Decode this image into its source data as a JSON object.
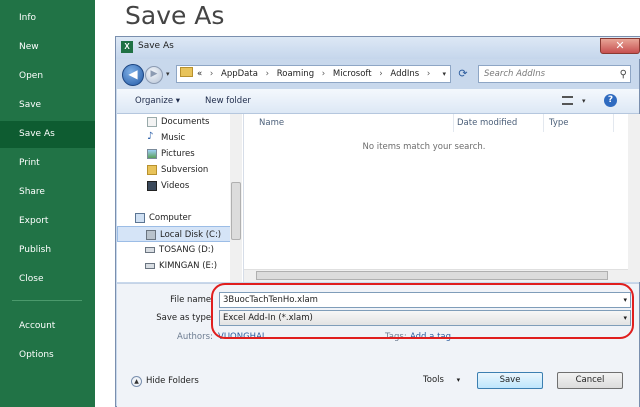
{
  "backstage": {
    "title": "Save As",
    "nav": [
      {
        "label": "Info",
        "active": false
      },
      {
        "label": "New",
        "active": false
      },
      {
        "label": "Open",
        "active": false
      },
      {
        "label": "Save",
        "active": false
      },
      {
        "label": "Save As",
        "active": true
      },
      {
        "label": "Print",
        "active": false
      },
      {
        "label": "Share",
        "active": false
      },
      {
        "label": "Export",
        "active": false
      },
      {
        "label": "Publish",
        "active": false
      },
      {
        "label": "Close",
        "active": false
      },
      {
        "label": "Account",
        "active": false
      },
      {
        "label": "Options",
        "active": false
      }
    ],
    "accent_color": "#217346"
  },
  "dialog": {
    "title": "Save As",
    "close_glyph": "✕",
    "address": {
      "prefix": "«",
      "path": [
        "AppData",
        "Roaming",
        "Microsoft",
        "AddIns"
      ]
    },
    "search_placeholder": "Search AddIns",
    "toolbar": {
      "organize_label": "Organize ▾",
      "new_folder_label": "New folder"
    },
    "nav_pane": [
      {
        "label": "Documents",
        "icon": "documents-icon"
      },
      {
        "label": "Music",
        "icon": "music-icon"
      },
      {
        "label": "Pictures",
        "icon": "pictures-icon"
      },
      {
        "label": "Subversion",
        "icon": "folder-icon"
      },
      {
        "label": "Videos",
        "icon": "videos-icon"
      },
      {
        "label": "Computer",
        "icon": "computer-icon"
      },
      {
        "label": "Local Disk (C:)",
        "icon": "disk-icon",
        "selected": true
      },
      {
        "label": "TOSANG (D:)",
        "icon": "drive-icon"
      },
      {
        "label": "KIMNGAN (E:)",
        "icon": "drive-icon"
      }
    ],
    "columns": [
      "Name",
      "Date modified",
      "Type"
    ],
    "empty_message": "No items match your search.",
    "form": {
      "file_name_label": "File name:",
      "file_name_value": "3BuocTachTenHo.xlam",
      "save_type_label": "Save as type:",
      "save_type_value": "Excel Add-In (*.xlam)",
      "authors_label": "Authors:",
      "authors_value": "VUONGHAI",
      "tags_label": "Tags:",
      "tags_value": "Add a tag"
    },
    "footer": {
      "hide_folders_label": "Hide Folders",
      "tools_label": "Tools",
      "save_label": "Save",
      "cancel_label": "Cancel"
    }
  }
}
